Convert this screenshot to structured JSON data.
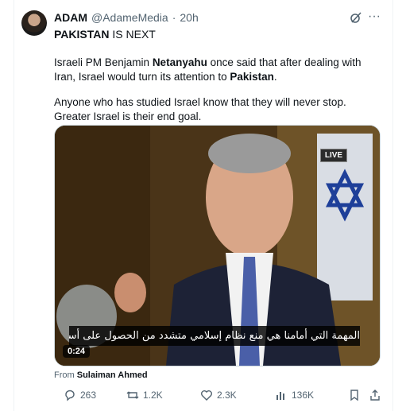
{
  "tweet": {
    "author_name": "ADAM",
    "handle": "@AdameMedia",
    "separator": "·",
    "time": "20h",
    "headline_bold": "PAKISTAN",
    "headline_rest": "IS NEXT",
    "para1_a": "Israeli PM Benjamin",
    "para1_bold1": "Netanyahu",
    "para1_b": "once said that after dealing with Iran, Israel would turn its attention to",
    "para1_bold2": "Pakistan",
    "para1_end": ".",
    "para2": "Anyone who has studied Israel know that they will never stop. Greater Israel is their end goal."
  },
  "video": {
    "live_badge": "LIVE",
    "caption_arabic": "المهمة التي أمامنا هي منع نظام إسلامي متشدد من الحصول على أسلحة نووية",
    "time_badge": "0:24"
  },
  "source": {
    "from_label": "From",
    "from_name": "Sulaiman Ahmed"
  },
  "actions": {
    "replies": "263",
    "reposts": "1.2K",
    "likes": "2.3K",
    "views": "136K"
  },
  "icons": {
    "more": "more-icon",
    "grok": "grok-icon",
    "reply": "reply-icon",
    "repost": "repost-icon",
    "like": "heart-icon",
    "views": "views-icon",
    "bookmark": "bookmark-icon",
    "share": "share-icon"
  }
}
